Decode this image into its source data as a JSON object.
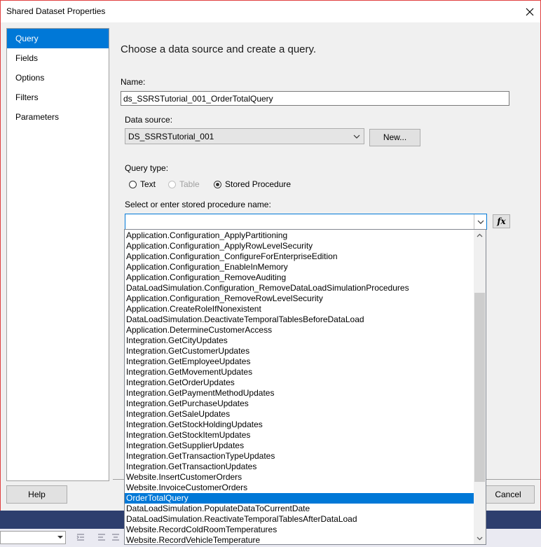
{
  "window": {
    "title": "Shared Dataset Properties",
    "close_glyph": "✕"
  },
  "nav": {
    "items": [
      {
        "label": "Query",
        "selected": true
      },
      {
        "label": "Fields",
        "selected": false
      },
      {
        "label": "Options",
        "selected": false
      },
      {
        "label": "Filters",
        "selected": false
      },
      {
        "label": "Parameters",
        "selected": false
      }
    ]
  },
  "main": {
    "heading": "Choose a data source and create a query.",
    "name_label": "Name:",
    "name_value": "ds_SSRSTutorial_001_OrderTotalQuery",
    "datasource_label": "Data source:",
    "datasource_value": "DS_SSRSTutorial_001",
    "new_button": "New...",
    "querytype_label": "Query type:",
    "querytype_options": [
      {
        "label": "Text",
        "checked": false,
        "disabled": false
      },
      {
        "label": "Table",
        "checked": false,
        "disabled": true
      },
      {
        "label": "Stored Procedure",
        "checked": true,
        "disabled": false
      }
    ],
    "sp_label": "Select or enter stored procedure name:",
    "sp_value": "",
    "fx_label": "fx"
  },
  "dropdown": {
    "selected_index": 25,
    "items": [
      "Application.Configuration_ApplyPartitioning",
      "Application.Configuration_ApplyRowLevelSecurity",
      "Application.Configuration_ConfigureForEnterpriseEdition",
      "Application.Configuration_EnableInMemory",
      "Application.Configuration_RemoveAuditing",
      "DataLoadSimulation.Configuration_RemoveDataLoadSimulationProcedures",
      "Application.Configuration_RemoveRowLevelSecurity",
      "Application.CreateRoleIfNonexistent",
      "DataLoadSimulation.DeactivateTemporalTablesBeforeDataLoad",
      "Application.DetermineCustomerAccess",
      "Integration.GetCityUpdates",
      "Integration.GetCustomerUpdates",
      "Integration.GetEmployeeUpdates",
      "Integration.GetMovementUpdates",
      "Integration.GetOrderUpdates",
      "Integration.GetPaymentMethodUpdates",
      "Integration.GetPurchaseUpdates",
      "Integration.GetSaleUpdates",
      "Integration.GetStockHoldingUpdates",
      "Integration.GetStockItemUpdates",
      "Integration.GetSupplierUpdates",
      "Integration.GetTransactionTypeUpdates",
      "Integration.GetTransactionUpdates",
      "Website.InsertCustomerOrders",
      "Website.InvoiceCustomerOrders",
      "OrderTotalQuery",
      "DataLoadSimulation.PopulateDataToCurrentDate",
      "DataLoadSimulation.ReactivateTemporalTablesAfterDataLoad",
      "Website.RecordColdRoomTemperatures",
      "Website.RecordVehicleTemperature"
    ]
  },
  "footer": {
    "help": "Help",
    "cancel": "Cancel"
  },
  "colors": {
    "accent": "#0078d7",
    "window_border": "#e04040",
    "taskbar": "#2d3e6e"
  }
}
